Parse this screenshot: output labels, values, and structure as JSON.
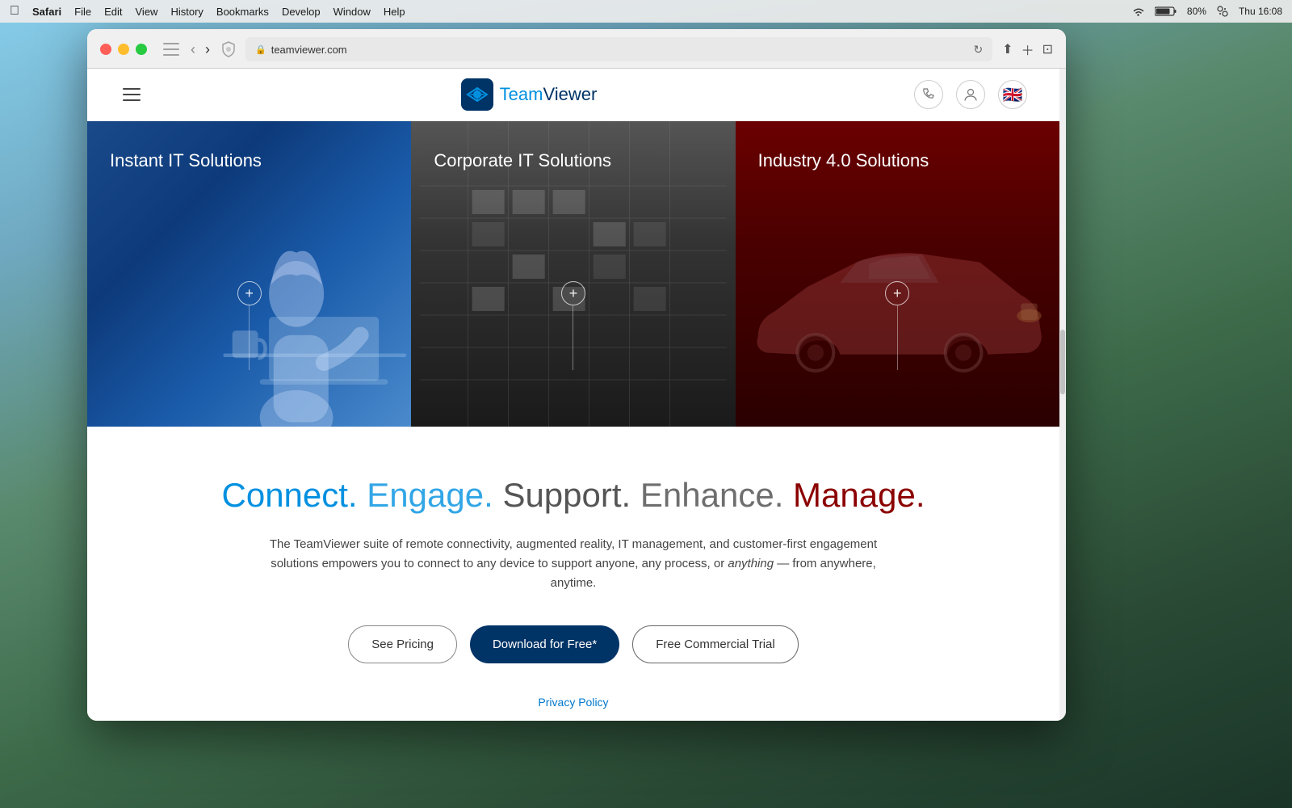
{
  "desktop": {
    "time": "Thu 16:08",
    "battery": "80%"
  },
  "menubar": {
    "apple": "&#63743;",
    "items": [
      "Safari",
      "File",
      "Edit",
      "View",
      "History",
      "Bookmarks",
      "Develop",
      "Window",
      "Help"
    ],
    "right_items": [
      "16:08",
      "Thu"
    ]
  },
  "safari": {
    "address": "teamviewer.com",
    "lock_icon": "&#128274;"
  },
  "header": {
    "logo_team": "Team",
    "logo_viewer": "Viewer",
    "hamburger_label": "Menu"
  },
  "cards": [
    {
      "id": "instant-it",
      "title": "Instant IT Solutions",
      "plus_label": "+"
    },
    {
      "id": "corporate-it",
      "title": "Corporate IT Solutions",
      "plus_label": "+"
    },
    {
      "id": "industry-40",
      "title": "Industry 4.0 Solutions",
      "plus_label": "+"
    }
  ],
  "main": {
    "headline_parts": [
      "Connect.",
      "Engage.",
      "Support.",
      "Enhance.",
      "Manage."
    ],
    "description_before": "The TeamViewer suite of remote connectivity, augmented reality, IT management, and customer-first engagement solutions empowers you to connect to any device to support anyone, any process, or ",
    "description_italic": "anything",
    "description_after": " — from anywhere, anytime.",
    "buttons": {
      "see_pricing": "See Pricing",
      "download_free": "Download for Free*",
      "free_trial": "Free Commercial Trial"
    },
    "privacy_link": "Privacy Policy"
  }
}
